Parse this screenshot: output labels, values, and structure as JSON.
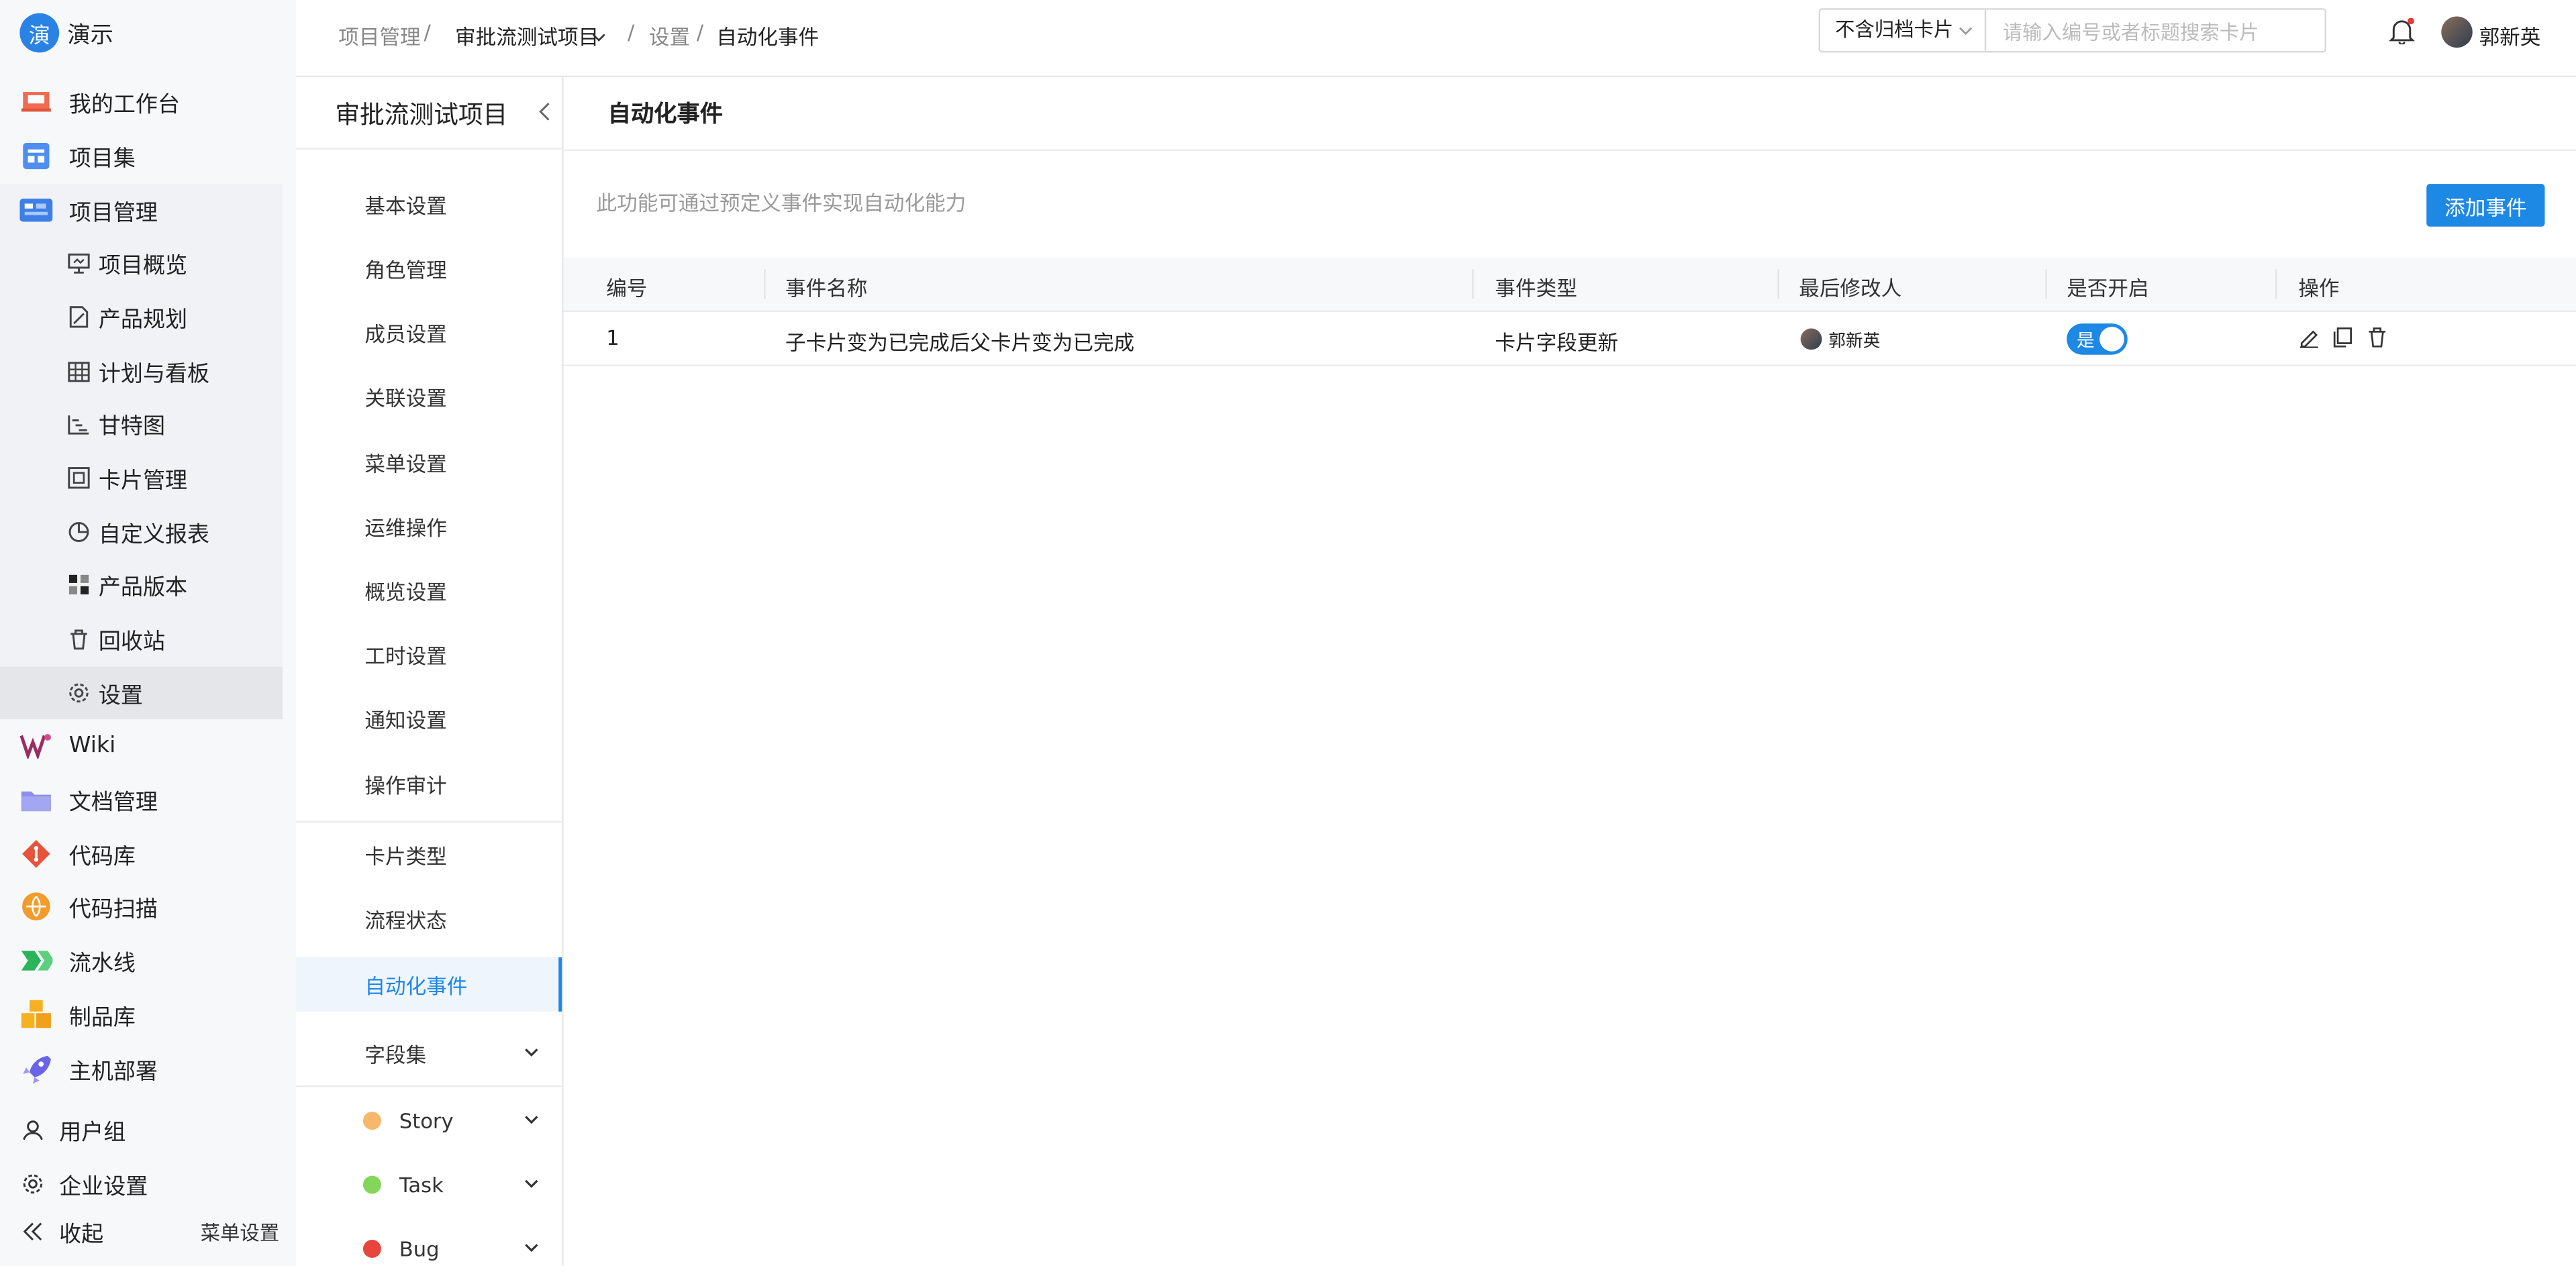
{
  "app": {
    "logo_char": "演",
    "org_name": "演示"
  },
  "sidebar": {
    "items": [
      {
        "label": "我的工作台",
        "icon": "workbench-icon"
      },
      {
        "label": "项目集",
        "icon": "project-set-icon"
      },
      {
        "label": "项目管理",
        "icon": "project-management-icon"
      }
    ],
    "sub_items": [
      {
        "label": "项目概览",
        "icon": "monitor-icon"
      },
      {
        "label": "产品规划",
        "icon": "planning-icon"
      },
      {
        "label": "计划与看板",
        "icon": "grid-icon"
      },
      {
        "label": "甘特图",
        "icon": "gantt-icon"
      },
      {
        "label": "卡片管理",
        "icon": "card-icon"
      },
      {
        "label": "自定义报表",
        "icon": "pie-icon"
      },
      {
        "label": "产品版本",
        "icon": "version-icon"
      },
      {
        "label": "回收站",
        "icon": "trash-icon"
      },
      {
        "label": "设置",
        "icon": "gear-icon"
      }
    ],
    "apps": [
      {
        "label": "Wiki",
        "icon": "wiki-icon"
      },
      {
        "label": "文档管理",
        "icon": "folder-icon"
      },
      {
        "label": "代码库",
        "icon": "git-icon"
      },
      {
        "label": "代码扫描",
        "icon": "scan-icon"
      },
      {
        "label": "流水线",
        "icon": "pipeline-icon"
      },
      {
        "label": "制品库",
        "icon": "artifact-icon"
      },
      {
        "label": "主机部署",
        "icon": "rocket-icon"
      }
    ],
    "user_group": "用户组",
    "enterprise_settings": "企业设置",
    "collapse": "收起",
    "menu_settings": "菜单设置"
  },
  "topbar": {
    "breadcrumb": {
      "project_mgmt": "项目管理",
      "sep": "/",
      "project": "审批流测试项目",
      "settings": "设置",
      "current": "自动化事件"
    },
    "filter_select": "不含归档卡片",
    "search_placeholder": "请输入编号或者标题搜索卡片",
    "user_name": "郭新英"
  },
  "subnav": {
    "title": "审批流测试项目",
    "items": [
      "基本设置",
      "角色管理",
      "成员设置",
      "关联设置",
      "菜单设置",
      "运维操作",
      "概览设置",
      "工时设置",
      "通知设置",
      "操作审计"
    ],
    "items2": [
      "卡片类型",
      "流程状态",
      "自动化事件"
    ],
    "field_set": "字段集",
    "types": [
      {
        "label": "Story",
        "color": "#f7b86b"
      },
      {
        "label": "Task",
        "color": "#84d65a"
      },
      {
        "label": "Bug",
        "color": "#e8453c"
      }
    ]
  },
  "main": {
    "title": "自动化事件",
    "description": "此功能可通过预定义事件实现自动化能力",
    "add_button": "添加事件",
    "table": {
      "headers": [
        "编号",
        "事件名称",
        "事件类型",
        "最后修改人",
        "是否开启",
        "操作"
      ],
      "rows": [
        {
          "id": "1",
          "name": "子卡片变为已完成后父卡片变为已完成",
          "type": "卡片字段更新",
          "modifier": "郭新英",
          "enabled_label": "是"
        }
      ]
    }
  }
}
